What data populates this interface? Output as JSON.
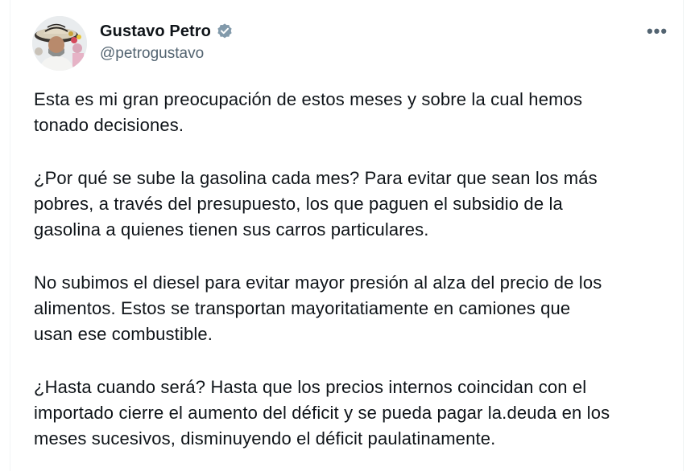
{
  "author": {
    "display_name": "Gustavo Petro",
    "handle": "@petrogustavo",
    "verified": true,
    "avatar_icon": "profile-photo",
    "verified_icon": "verified-badge-icon"
  },
  "menu": {
    "more_label": "•••"
  },
  "tweet": {
    "paragraphs": [
      [
        "Esta es mi gran preocupación de estos meses y sobre la cual hemos",
        "tonado decisiones."
      ],
      [
        "¿Por qué se sube la gasolina cada mes? Para evitar que sean los más",
        "pobres, a través del presupuesto, los que paguen el subsidio de la",
        "gasolina a quienes tienen sus carros particulares."
      ],
      [
        "No subimos el diesel para evitar mayor presión al alza del precio de los",
        "alimentos. Estos se transportan mayoritatiamente en camiones que",
        "usan ese combustible."
      ],
      [
        "¿Hasta cuando será? Hasta que los precios internos coincidan con el",
        "importado cierre el aumento del déficit y se pueda pagar la.deuda en los",
        "meses sucesivos, disminuyendo el déficit paulatinamente."
      ]
    ]
  },
  "colors": {
    "text": "#0f1419",
    "secondary_text": "#536471",
    "verified": "#829aab",
    "background": "#ffffff"
  }
}
